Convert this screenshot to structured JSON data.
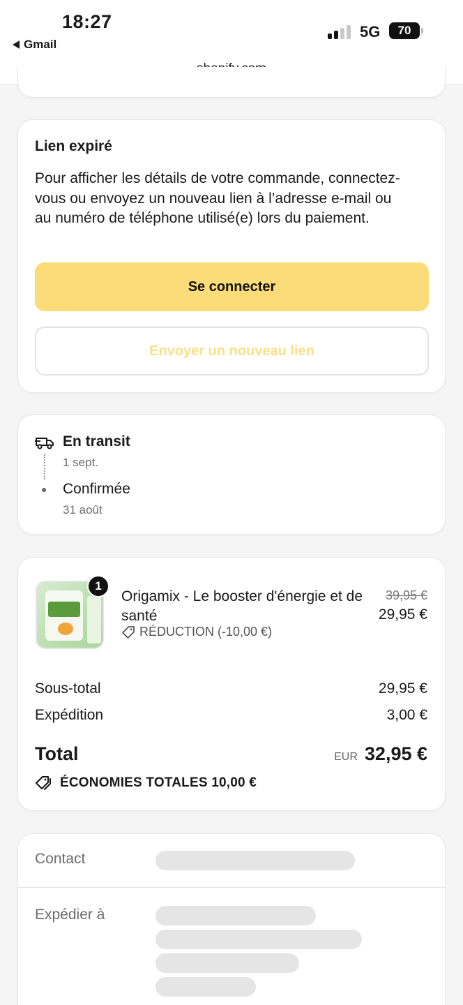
{
  "status_bar": {
    "time": "18:27",
    "back_app": "Gmail",
    "network": "5G",
    "battery": "70"
  },
  "browser": {
    "url": "shopify.com"
  },
  "link_card": {
    "title": "Lien expiré",
    "description": "Pour afficher les détails de votre commande, connectez-vous ou envoyez un nouveau lien à l’adresse e-mail ou au numéro de téléphone utilisé(e) lors du paiement.",
    "login_button": "Se connecter",
    "resend_button": "Envoyer un nouveau lien"
  },
  "shipment": {
    "steps": [
      {
        "label": "En transit",
        "date": "1 sept."
      },
      {
        "label": "Confirmée",
        "date": "31 août"
      }
    ]
  },
  "order": {
    "item": {
      "quantity": "1",
      "name": "Origamix - Le booster d'énergie et de santé",
      "discount": "RÉDUCTION (-10,00 €)",
      "old_price": "39,95 €",
      "price": "29,95 €"
    },
    "subtotal_label": "Sous-total",
    "subtotal_value": "29,95 €",
    "shipping_label": "Expédition",
    "shipping_value": "3,00 €",
    "total_label": "Total",
    "currency": "EUR",
    "total_value": "32,95 €",
    "savings": "ÉCONOMIES TOTALES 10,00 €"
  },
  "contact": {
    "contact_label": "Contact",
    "ship_to_label": "Expédier à"
  },
  "colors": {
    "primary_button": "#fcdc78",
    "secondary_text": "#fbe08a",
    "background": "#f5f5f5"
  }
}
